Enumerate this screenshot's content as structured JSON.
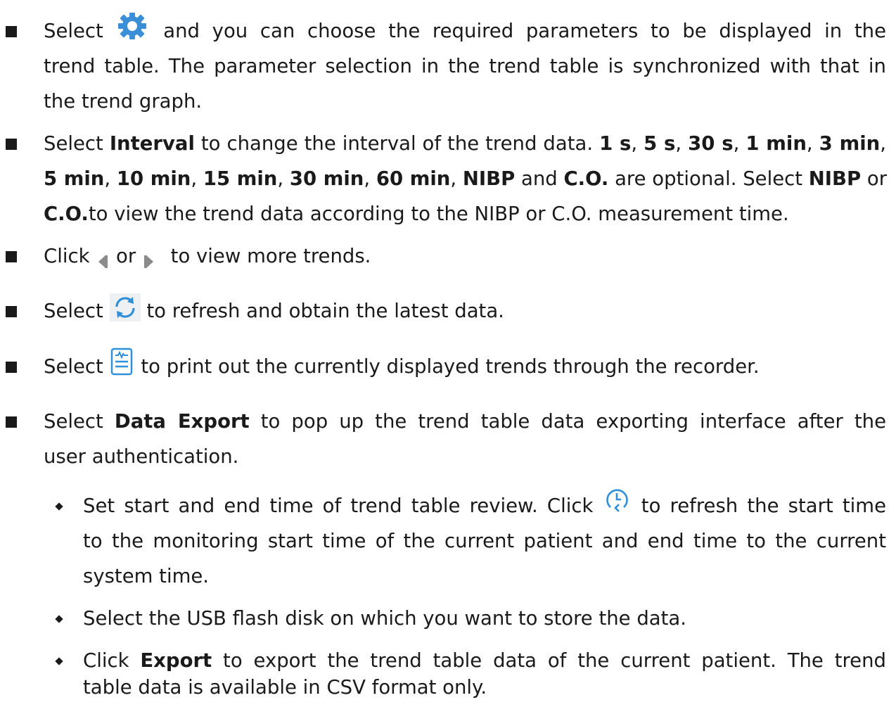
{
  "items": [
    {
      "lines": [
        [
          "Select",
          "and you can choose the required parameters to be displayed in the"
        ],
        [
          "trend table. The parameter selection in the trend table is synchronized with that in"
        ],
        [
          "the trend graph."
        ]
      ],
      "icon": "gear-icon"
    },
    {
      "line1": {
        "t1": "Select ",
        "b1": "Interval",
        "t2": " to change the interval of the trend data. ",
        "b2": "1 s",
        "c1": ", ",
        "b3": "5 s",
        "c2": ", ",
        "b4": "30 s",
        "c3": ", ",
        "b5": "1 min",
        "c4": ", ",
        "b6": "3 min",
        "c5": ","
      },
      "line2": {
        "b1": "5 min",
        "c1": ", ",
        "b2": "10 min",
        "c2": ", ",
        "b3": "15 min",
        "c3": ", ",
        "b4": "30 min",
        "c4": ", ",
        "b5": "60 min",
        "c5": ", ",
        "b6": "NIBP",
        "t1": " and ",
        "b7": "C.O.",
        "t2": " are optional. Select ",
        "b8": "NIBP",
        "t3": " or"
      },
      "line3": {
        "b1": "C.O.",
        "t1": "to view the trend data according to the NIBP or C.O. measurement time."
      }
    },
    {
      "t1": "Click",
      "t2": "or",
      "t3": "to view more trends.",
      "icons": [
        "arrow-left-icon",
        "arrow-right-icon"
      ]
    },
    {
      "t1": "Select",
      "t2": "to refresh and obtain the latest data.",
      "icon": "refresh-icon"
    },
    {
      "t1": "Select",
      "t2": "to print out the currently displayed trends through the recorder.",
      "icon": "record-icon"
    },
    {
      "line1": {
        "t1": "Select ",
        "b1": "Data Export",
        "t2": " to pop up the trend table data exporting interface after the"
      },
      "line2": "user authentication.",
      "subitems": [
        {
          "line1": {
            "t1": "Set start and end time of trend table review. Click",
            "t2": "to refresh the start time"
          },
          "line2": "to the monitoring start time of the current patient and end time to the current",
          "line3": "system time.",
          "icon": "time-reset-icon"
        },
        {
          "line1": "Select the USB flash disk on which you want to store the data."
        },
        {
          "line1": {
            "t1": "Click ",
            "b1": "Export",
            "t2": " to export the trend table data of the current patient. The trend"
          },
          "line2": "table data is available in CSV format only."
        }
      ]
    }
  ]
}
